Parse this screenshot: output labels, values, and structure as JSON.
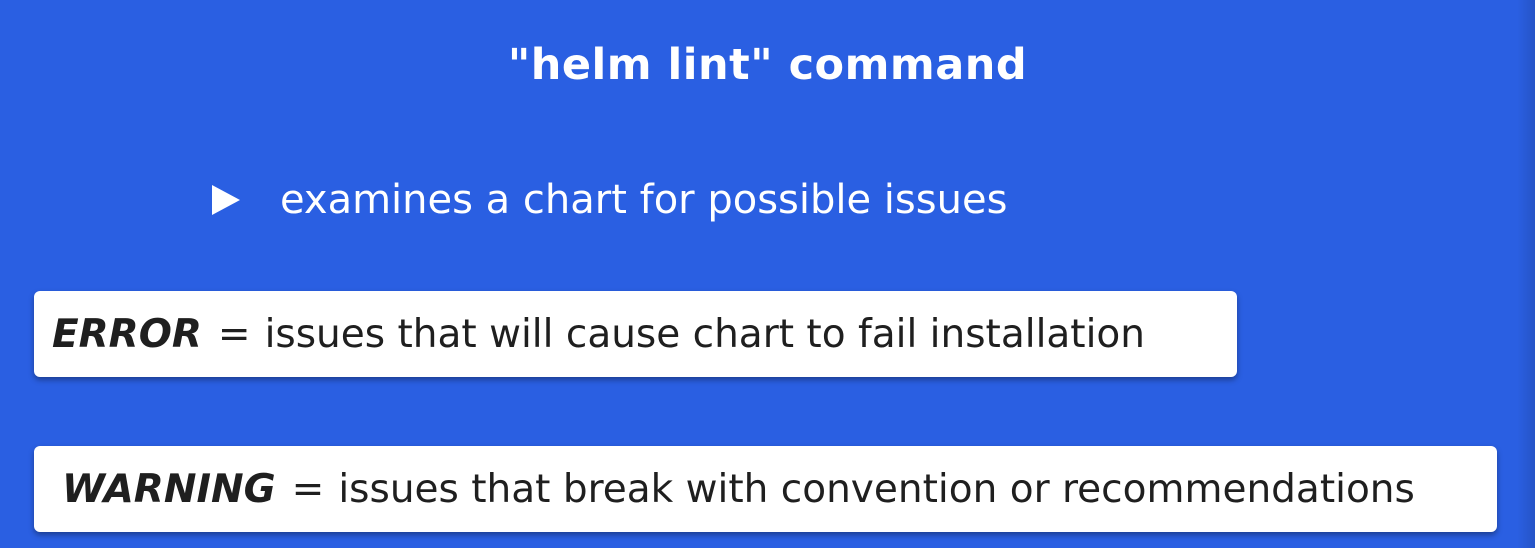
{
  "slide": {
    "title": "\"helm lint\" command",
    "bullet": {
      "icon": "play-triangle-icon",
      "text": "examines a chart for possible issues"
    },
    "definitions": [
      {
        "term": "ERROR",
        "separator": "=",
        "description": "issues that will cause chart to fail installation"
      },
      {
        "term": "WARNING",
        "separator": "=",
        "description": "issues that break with convention or recommendations"
      }
    ]
  },
  "colors": {
    "background": "#2a5fe2",
    "text_light": "#ffffff",
    "box_background": "#ffffff",
    "box_text": "#1f1f1f"
  }
}
